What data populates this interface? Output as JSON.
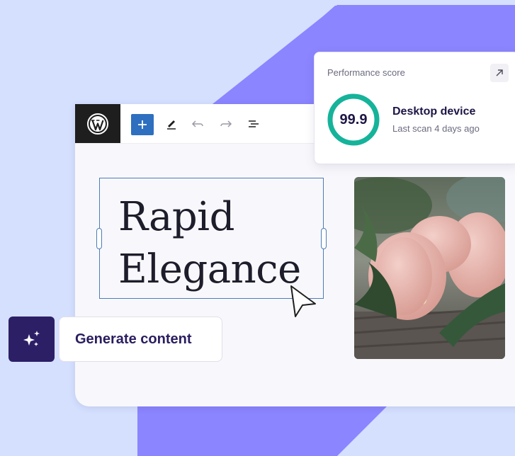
{
  "colors": {
    "background": "#d5e0ff",
    "accent_shape": "#8b85ff",
    "score_ring": "#15b39a",
    "brand_dark": "#2c1f66"
  },
  "toolbar": {
    "logo_icon": "wordpress-icon",
    "tools": [
      "plus-icon",
      "pen-icon",
      "undo-icon",
      "redo-icon",
      "list-view-icon"
    ]
  },
  "editor": {
    "heading_line1": "Rapid",
    "heading_line2": "Elegance",
    "image": "macarons-photo"
  },
  "performance": {
    "label": "Performance score",
    "score": "99.9",
    "score_fraction": 0.999,
    "device_title": "Desktop device",
    "device_sub": "Last scan 4 days ago"
  },
  "actions": {
    "generate_label": "Generate content",
    "sparkle_icon": "sparkles-icon"
  }
}
